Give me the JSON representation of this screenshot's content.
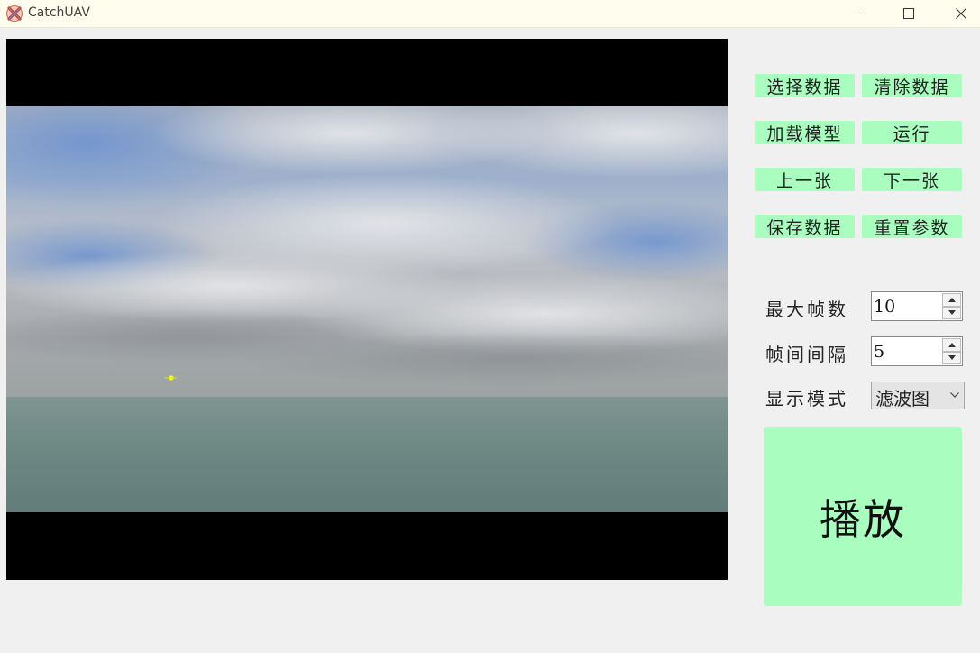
{
  "window": {
    "title": "CatchUAV"
  },
  "buttons": {
    "select_data": "选择数据",
    "clear_data": "清除数据",
    "load_model": "加载模型",
    "run": "运行",
    "prev": "上一张",
    "next": "下一张",
    "save_data": "保存数据",
    "reset_params": "重置参数",
    "play": "播放"
  },
  "settings": {
    "max_frames_label": "最大帧数",
    "max_frames_value": "10",
    "frame_interval_label": "帧间间隔",
    "frame_interval_value": "5",
    "display_mode_label": "显示模式",
    "display_mode_value": "滤波图"
  },
  "colors": {
    "button_bg": "#a8fdbf",
    "titlebar_bg": "#fefdee",
    "window_bg": "#f0f0f0",
    "detection_marker": "#ffff00"
  },
  "icons": {
    "app": "crossed-x-app-icon",
    "minimize": "minimize-icon",
    "maximize": "maximize-icon",
    "close": "close-icon"
  }
}
